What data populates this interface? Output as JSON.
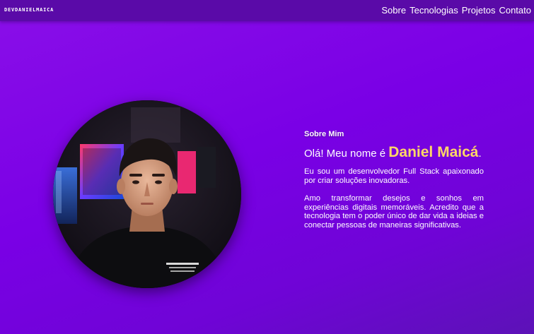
{
  "navbar": {
    "logo": "DEVDANIELMAICA",
    "links": [
      "Sobre",
      "Tecnologias",
      "Projetos",
      "Contato"
    ]
  },
  "about": {
    "heading": "Sobre Mim",
    "greeting_prefix": "Olá! Meu nome é ",
    "name": "Daniel Maicá",
    "greeting_suffix": ".",
    "paragraph1": "Eu sou um desenvolvedor Full Stack apaixonado por criar soluções inovadoras.",
    "paragraph2": "Amo transformar desejos e sonhos em experiências digitais memoráveis. Acredito que a tecnologia tem o poder único de dar vida a ideias e conectar pessoas de maneiras significativas."
  },
  "colors": {
    "background": "#7a00e6",
    "navbar": "#5a0aa8",
    "accent_name": "#ffd766",
    "text": "#ffffff"
  }
}
